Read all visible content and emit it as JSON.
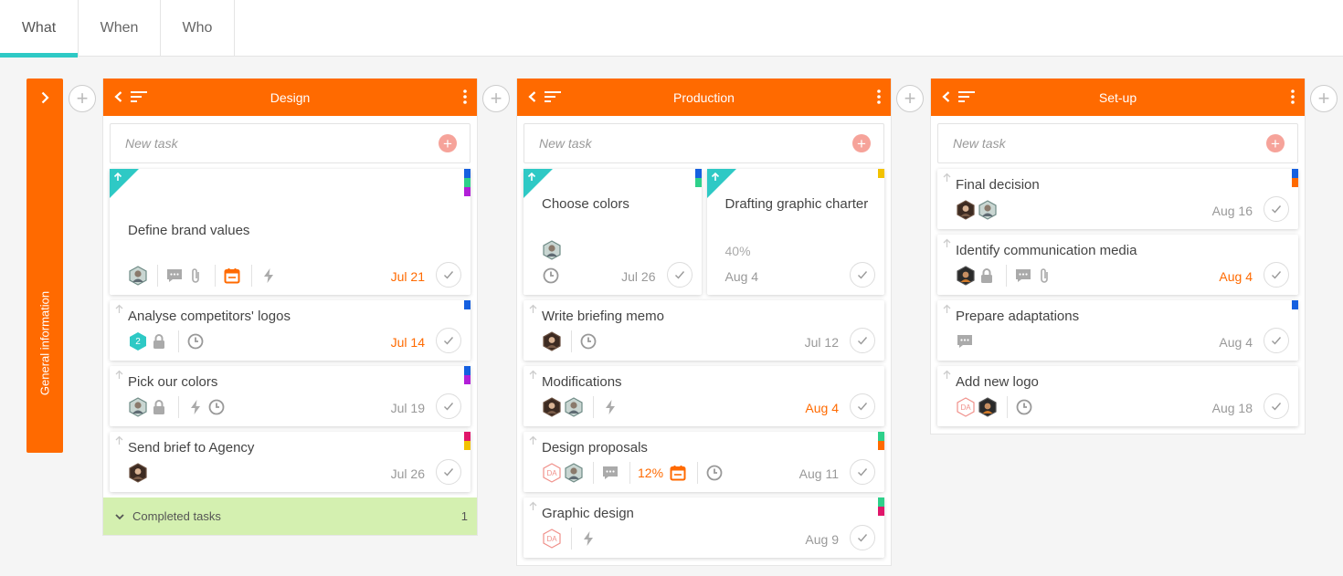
{
  "tabs": [
    {
      "label": "What"
    },
    {
      "label": "When"
    },
    {
      "label": "Who"
    }
  ],
  "sidebar": {
    "title": "General information"
  },
  "new_task_placeholder": "New task",
  "colors": {
    "accent": "#ff6a00",
    "tab_active": "#2ec9c5",
    "completed_bg": "#d4f0b0"
  },
  "columns": [
    {
      "title": "Design",
      "completed": {
        "label": "Completed tasks",
        "count": "1"
      },
      "cards": [
        {
          "title": "Define brand values",
          "due": "Jul 21"
        },
        {
          "title": "Analyse competitors' logos",
          "due": "Jul 14",
          "badge": "2"
        },
        {
          "title": "Pick our colors",
          "due": "Jul 19"
        },
        {
          "title": "Send brief to Agency",
          "due": "Jul 26"
        }
      ]
    },
    {
      "title": "Production",
      "cards": [
        {
          "title": "Choose colors",
          "due": "Jul 26"
        },
        {
          "title": "Drafting graphic charter",
          "due": "Aug 4",
          "progress": "40%"
        },
        {
          "title": "Write briefing memo",
          "due": "Jul 12"
        },
        {
          "title": "Modifications",
          "due": "Aug 4"
        },
        {
          "title": "Design proposals",
          "due": "Aug 11",
          "progress": "12%",
          "initials": "DA"
        },
        {
          "title": "Graphic design",
          "due": "Aug 9",
          "initials": "DA"
        }
      ]
    },
    {
      "title": "Set-up",
      "cards": [
        {
          "title": "Final decision",
          "due": "Aug 16"
        },
        {
          "title": "Identify communication media",
          "due": "Aug 4"
        },
        {
          "title": "Prepare adaptations",
          "due": "Aug 4"
        },
        {
          "title": "Add new logo",
          "due": "Aug 18",
          "initials": "DA"
        }
      ]
    }
  ]
}
